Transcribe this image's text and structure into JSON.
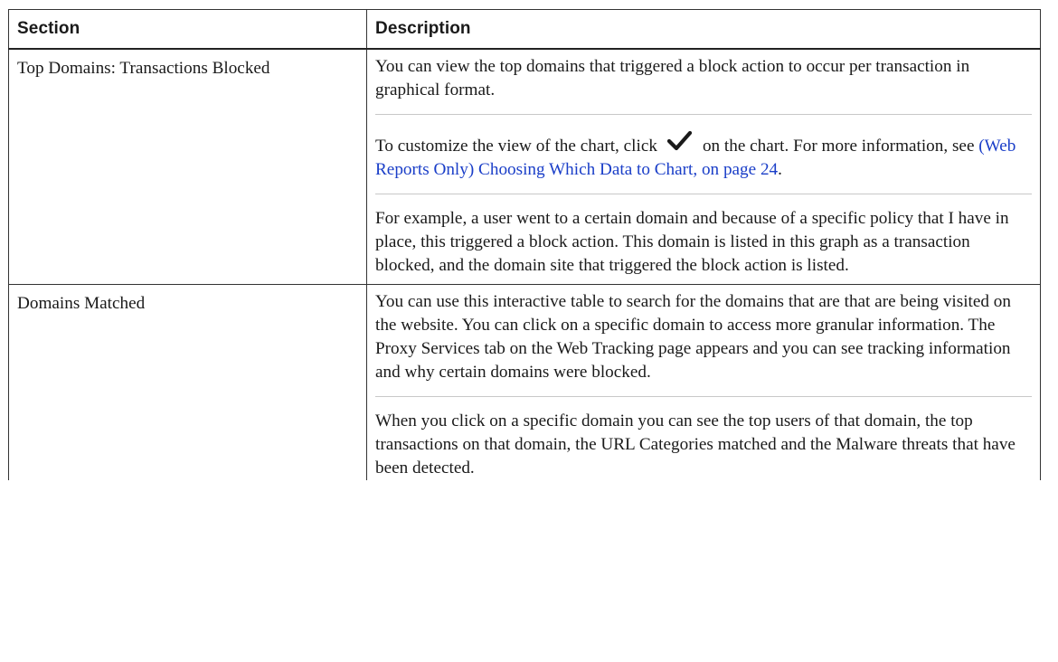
{
  "table": {
    "headers": {
      "section": "Section",
      "description": "Description"
    },
    "rows": [
      {
        "section": "Top Domains: Transactions Blocked",
        "paragraphs": {
          "p1": "You can view the top domains that triggered a block action to occur per transaction in graphical format.",
          "p2_before_icon": "To customize the view of the chart, click",
          "p2_icon": "checkmark-icon",
          "p2_after_icon": "on the chart. For more information, see",
          "p2_link": "(Web Reports Only) Choosing Which Data to Chart, on page 24",
          "p2_end": ".",
          "p3": "For example, a user went to a certain domain and because of a specific policy that I have in place, this triggered a block action. This domain is listed in this graph as a transaction blocked, and the domain site that triggered the block action is listed."
        }
      },
      {
        "section": "Domains Matched",
        "paragraphs": {
          "p1": "You can use this interactive table to search for the domains that are that are being visited on the website. You can click on a specific domain to access more granular information. The Proxy Services tab on the Web Tracking page appears and you can see tracking information and why certain domains were blocked.",
          "p2": "When you click on a specific domain you can see the top users of that domain, the top transactions on that domain, the URL Categories matched and the Malware threats that have been detected."
        }
      }
    ]
  },
  "colors": {
    "link": "#1a3ec8",
    "text": "#1a1a1a",
    "border": "#333333"
  }
}
